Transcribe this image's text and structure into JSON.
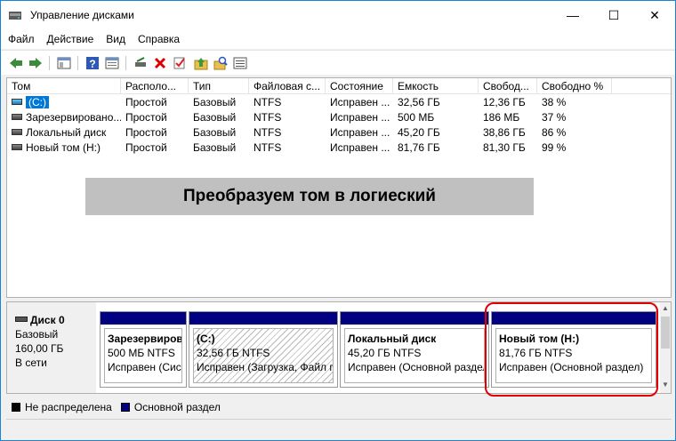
{
  "window": {
    "title": "Управление дисками",
    "minimize_glyph": "—",
    "maximize_glyph": "☐",
    "close_glyph": "✕"
  },
  "menu": [
    "Файл",
    "Действие",
    "Вид",
    "Справка"
  ],
  "toolbar_icons": [
    "back-arrow-icon",
    "forward-arrow-icon",
    "console-tree-icon",
    "help-icon",
    "properties-icon",
    "connect-drive-icon",
    "delete-icon",
    "check-icon",
    "folder-up-icon",
    "search-icon",
    "list-view-icon"
  ],
  "table": {
    "headers": [
      "Том",
      "Располо...",
      "Тип",
      "Файловая с...",
      "Состояние",
      "Емкость",
      "Свобод...",
      "Свободно %"
    ],
    "rows": [
      {
        "name": "(C:)",
        "layout": "Простой",
        "type": "Базовый",
        "fs": "NTFS",
        "status": "Исправен ...",
        "capacity": "32,56 ГБ",
        "free": "12,36 ГБ",
        "free_pct": "38 %"
      },
      {
        "name": "Зарезервировано...",
        "layout": "Простой",
        "type": "Базовый",
        "fs": "NTFS",
        "status": "Исправен ...",
        "capacity": "500 МБ",
        "free": "186 МБ",
        "free_pct": "37 %"
      },
      {
        "name": "Локальный диск",
        "layout": "Простой",
        "type": "Базовый",
        "fs": "NTFS",
        "status": "Исправен ...",
        "capacity": "45,20 ГБ",
        "free": "38,86 ГБ",
        "free_pct": "86 %"
      },
      {
        "name": "Новый том (H:)",
        "layout": "Простой",
        "type": "Базовый",
        "fs": "NTFS",
        "status": "Исправен ...",
        "capacity": "81,76 ГБ",
        "free": "81,30 ГБ",
        "free_pct": "99 %"
      }
    ]
  },
  "banner": "Преобразуем том в логиеский",
  "disk": {
    "title": "Диск 0",
    "type": "Базовый",
    "size": "160,00 ГБ",
    "status": "В сети"
  },
  "partitions": [
    {
      "name": "Зарезервиров",
      "info": "500 МБ NTFS",
      "status": "Исправен (Сис"
    },
    {
      "name": "(C:)",
      "info": "32,56 ГБ NTFS",
      "status": "Исправен (Загрузка, Файл г"
    },
    {
      "name": "Локальный диск",
      "info": "45,20 ГБ NTFS",
      "status": "Исправен (Основной раздел"
    },
    {
      "name": "Новый том  (H:)",
      "info": "81,76 ГБ NTFS",
      "status": "Исправен (Основной раздел)"
    }
  ],
  "legend": [
    {
      "label": "Не распределена",
      "color": "#000000"
    },
    {
      "label": "Основной раздел",
      "color": "#000080"
    }
  ],
  "colors": {
    "partition_header": "#000080",
    "highlight": "#e00000",
    "selection": "#0078d7"
  }
}
